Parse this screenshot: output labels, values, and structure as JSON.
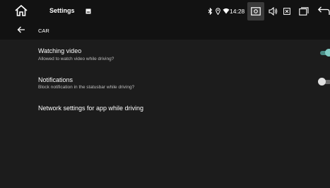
{
  "statusbar": {
    "title": "Settings",
    "time": "14:28",
    "icons": [
      "home-icon",
      "notification-card-icon",
      "bluetooth-icon",
      "location-icon",
      "wifi-icon",
      "screenshot-icon",
      "volume-icon",
      "close-box-icon",
      "recent-apps-icon",
      "back-icon"
    ]
  },
  "header": {
    "title": "CAR",
    "back_icon": "arrow-back-icon"
  },
  "rows": [
    {
      "title": "Watching video",
      "subtitle": "Allowed to watch video while driving?",
      "toggle_on": true
    },
    {
      "title": "Notifications",
      "subtitle": "Block notification in the statusbar while driving?",
      "toggle_on": false
    },
    {
      "title": "Network settings for app while driving"
    }
  ],
  "colors": {
    "accent": "#80cbc4",
    "accent_track": "#4a8c86",
    "off_thumb": "#e0e0e0",
    "off_track": "#6b6b6b"
  }
}
